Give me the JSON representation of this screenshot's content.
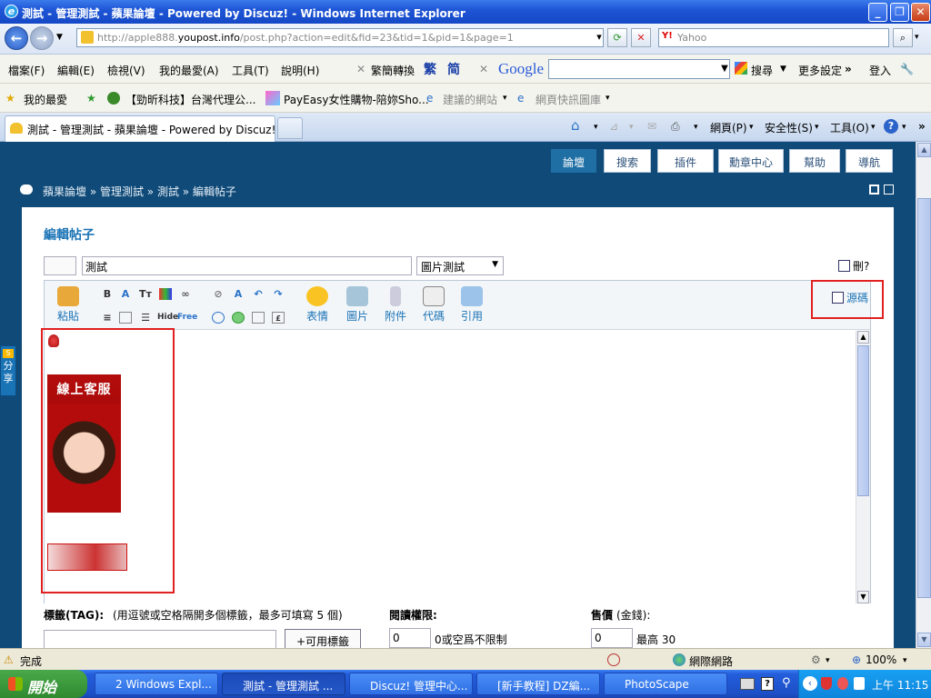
{
  "window": {
    "title": "測試 - 管理測試 - 蘋果論壇 - Powered by Discuz! - Windows Internet Explorer",
    "min": "_",
    "max": "❐",
    "close": "✕"
  },
  "addressbar": {
    "url_pre": "http://apple888.",
    "url_host": "youpost.info",
    "url_post": "/post.php?action=edit&fid=23&tid=1&pid=1&page=1",
    "search_placeholder": "Yahoo",
    "search_brand": "Y!"
  },
  "menubar": {
    "items": [
      "檔案(F)",
      "編輯(E)",
      "檢視(V)",
      "我的最愛(A)",
      "工具(T)",
      "說明(H)"
    ],
    "convert": "繁簡轉換",
    "trad": "繁",
    "simp": "简",
    "google": "Google",
    "search_btn": "搜尋",
    "more": "更多設定",
    "login": "登入"
  },
  "favbar": {
    "fav": "我的最愛",
    "items": [
      "【勁昕科技】台灣代理公...",
      "PayEasy女性購物-陪妳Sho...",
      "建議的網站",
      "網頁快訊圖庫"
    ]
  },
  "tabbar": {
    "tab_title": "測試 - 管理測試 - 蘋果論壇 - Powered by Discuz!",
    "page": "網頁(P)",
    "safety": "安全性(S)",
    "tools": "工具(O)",
    "help": "?"
  },
  "forum": {
    "nav": [
      "論壇",
      "搜索",
      "插件",
      "勳章中心",
      "幫助",
      "導航"
    ],
    "breadcrumb": "蘋果論壇 » 管理測試 » 測試 » 編輯帖子",
    "heading": "編輯帖子",
    "subject": "測試",
    "type": "圖片測試",
    "delete_label": "刪?",
    "source_label": "源碼",
    "toolbar": {
      "paste": "粘貼",
      "emoticon": "表情",
      "image": "圖片",
      "attach": "附件",
      "code": "代碼",
      "quote": "引用",
      "hide": "Hide",
      "free": "Free"
    },
    "service_label": "線上客服",
    "tag_label": "標籤(TAG):",
    "tag_hint": "(用逗號或空格隔開多個標籤，最多可填寫 5 個)",
    "tag_btn": "+可用標籤",
    "read_label": "閱讀權限:",
    "read_value": "0",
    "read_hint": "0或空爲不限制",
    "price_label": "售價",
    "price_unit": "(金錢):",
    "price_value": "0",
    "price_hint": "最高 30",
    "share": "分享"
  },
  "status": {
    "done": "完成",
    "zone": "網際網路",
    "zoom": "100%"
  },
  "taskbar": {
    "start": "開始",
    "items": [
      "2 Windows Expl...",
      "測試 - 管理測試 ...",
      "Discuz! 管理中心...",
      "[新手教程] DZ編...",
      "PhotoScape"
    ],
    "time": "上午 11:15"
  }
}
